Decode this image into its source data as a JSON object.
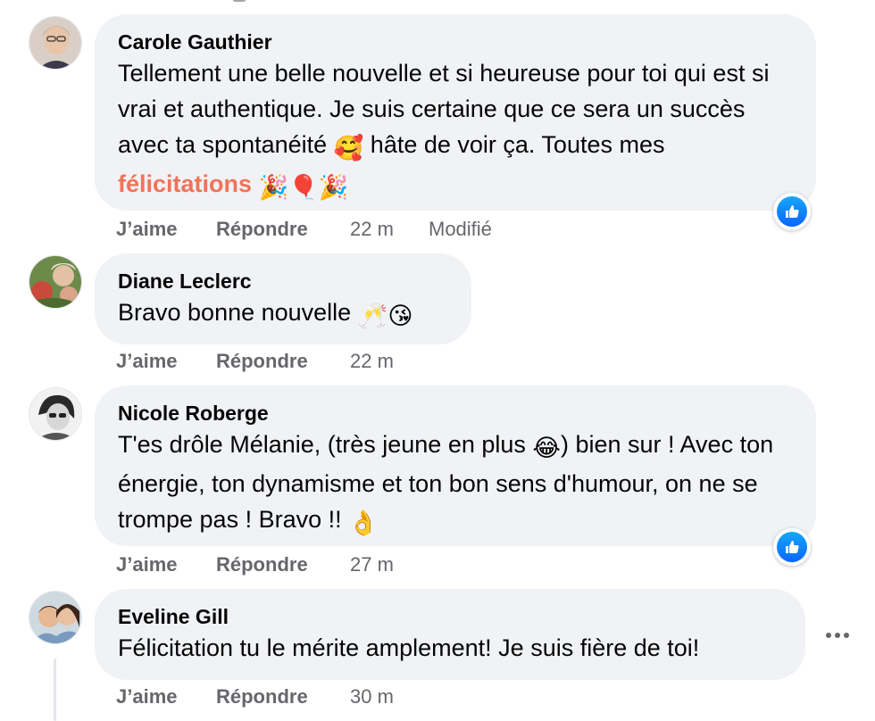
{
  "comments": [
    {
      "author": "Carole Gauthier",
      "text_parts": [
        "Tellement une belle nouvelle et si heureuse pour toi qui est si vrai et authentique. Je suis certaine que ce sera un succès avec ta spontanéité ",
        " hâte de voir ça. Toutes mes ",
        "félicitations",
        " "
      ],
      "emojis": [
        "🥰",
        "🎉",
        "🎈",
        "🎉"
      ],
      "like_label": "J’aime",
      "reply_label": "Répondre",
      "time": "22 m",
      "edited": "Modifié",
      "reaction": "like"
    },
    {
      "author": "Diane Leclerc",
      "text": "Bravo bonne nouvelle ",
      "emojis": [
        "🥂",
        "😘"
      ],
      "like_label": "J’aime",
      "reply_label": "Répondre",
      "time": "22 m"
    },
    {
      "author": "Nicole Roberge",
      "text_parts": [
        "T'es drôle Mélanie, (très jeune en plus ",
        ") bien sur ! Avec ton énergie, ton dynamisme et ton bon sens d'humour, on ne se trompe pas ! Bravo !! "
      ],
      "emojis": [
        "😂",
        "👌"
      ],
      "like_label": "J’aime",
      "reply_label": "Répondre",
      "time": "27 m",
      "reaction": "like"
    },
    {
      "author": "Eveline Gill",
      "text": "Félicitation tu le mérite amplement! Je suis fière de toi!",
      "like_label": "J’aime",
      "reply_label": "Répondre",
      "time": "30 m"
    }
  ],
  "icons": {
    "reaction": "thumbs-up-icon",
    "more": "more-horizontal-icon"
  },
  "colors": {
    "bubble": "#f0f2f5",
    "meta": "#65676b",
    "highlight": "#f0735a",
    "like_blue": "#0866ff"
  }
}
